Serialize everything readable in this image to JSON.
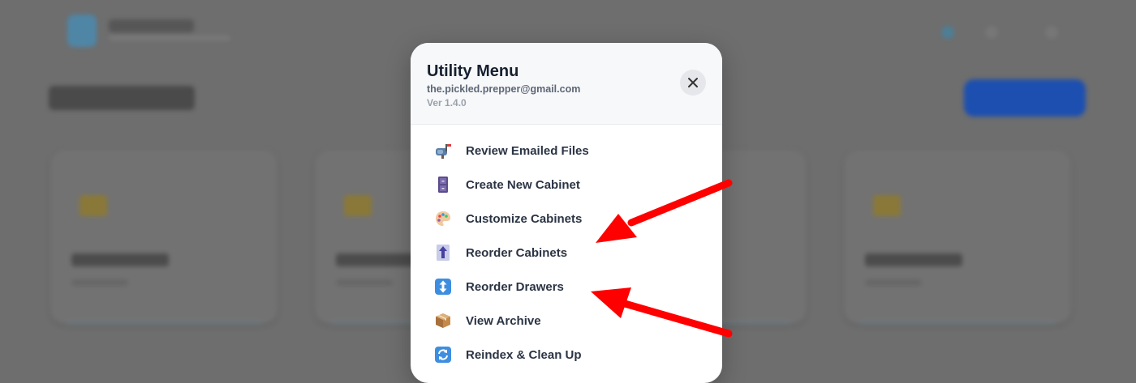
{
  "modal": {
    "title": "Utility Menu",
    "email": "the.pickled.prepper@gmail.com",
    "version": "Ver 1.4.0",
    "close_icon": "close-icon"
  },
  "menu": {
    "items": [
      {
        "label": "Review Emailed Files",
        "icon": "mailbox-icon"
      },
      {
        "label": "Create New Cabinet",
        "icon": "file-cabinet-icon"
      },
      {
        "label": "Customize Cabinets",
        "icon": "palette-icon"
      },
      {
        "label": "Reorder Cabinets",
        "icon": "up-arrow-icon"
      },
      {
        "label": "Reorder Drawers",
        "icon": "up-down-arrow-icon"
      },
      {
        "label": "View Archive",
        "icon": "package-icon"
      },
      {
        "label": "Reindex & Clean Up",
        "icon": "refresh-icon"
      }
    ]
  },
  "annotations": {
    "arrow_color": "#ff0000"
  },
  "colors": {
    "overlay": "#6e6e6e",
    "primary": "#1c4fb0",
    "title_text": "#16202f",
    "item_text": "#2b3444"
  }
}
